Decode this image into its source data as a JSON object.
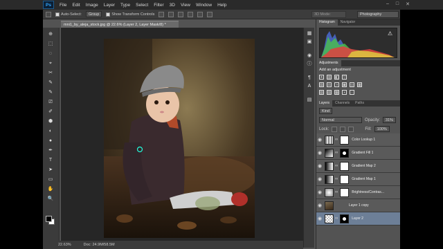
{
  "app": {
    "logo": "Ps"
  },
  "menu": [
    "File",
    "Edit",
    "Image",
    "Layer",
    "Type",
    "Select",
    "Filter",
    "3D",
    "View",
    "Window",
    "Help"
  ],
  "window_controls": [
    "–",
    "□",
    "✕"
  ],
  "options": {
    "auto_select_label": "Auto-Select:",
    "auto_select_value": "Group",
    "show_transform_label": "Show Transform Controls",
    "mode_3d": "3D Mode:",
    "workspace": "Photography"
  },
  "document": {
    "tab_title": "mni1_by_aleja_stock.jpg @ 22.6% (Layer 2, Layer Mask/8) *",
    "zoom": "22.63%",
    "doc_size": "Doc: 24.9M/58.5M"
  },
  "panels": {
    "histogram_tabs": [
      "Histogram",
      "Navigator"
    ],
    "adjustment_tabs": [
      "Adjustments"
    ],
    "adjustment_title": "Add an adjustment",
    "adjust_icons_row1": [
      "☀",
      "▥",
      "◧",
      "▽"
    ],
    "adjust_icons_row2": [
      "▤",
      "⚖",
      "◑",
      "▣",
      "◎",
      "▦"
    ],
    "adjust_icons_row3": [
      "▧",
      "▨",
      "▩",
      "▪",
      "▫"
    ],
    "layers_tabs": [
      "Layers",
      "Channels",
      "Paths"
    ],
    "kind_label": "Kind",
    "blend_mode": "Normal",
    "opacity_label": "Opacity:",
    "opacity_value": "31%",
    "lock_label": "Lock:",
    "fill_label": "Fill:",
    "fill_value": "100%"
  },
  "layers": [
    {
      "name": "Color Lookup 1",
      "thumb": "adj",
      "mask": "white"
    },
    {
      "name": "Gradient Fill 1",
      "thumb": "grad",
      "mask": "blk"
    },
    {
      "name": "Gradient Map 2",
      "thumb": "adj",
      "mask": "white"
    },
    {
      "name": "Gradient Map 1",
      "thumb": "adj",
      "mask": "white"
    },
    {
      "name": "Brightness/Contras...",
      "thumb": "adj",
      "mask": "white"
    },
    {
      "name": "Layer 1 copy",
      "thumb": "img",
      "mask": ""
    },
    {
      "name": "Layer 2",
      "thumb": "img",
      "mask": "blk",
      "selected": true
    }
  ],
  "tools": [
    "⊕",
    "⬚",
    "◌",
    "⌖",
    "✂",
    "✎",
    "✎",
    "⎚",
    "✐",
    "⬢",
    "◐",
    "●",
    "✒",
    "T",
    "➤",
    "▭",
    "✋",
    "🔍"
  ],
  "mini_icons": [
    "▦",
    "▣",
    "◉",
    "ⓘ",
    "¶",
    "A",
    "▤"
  ]
}
